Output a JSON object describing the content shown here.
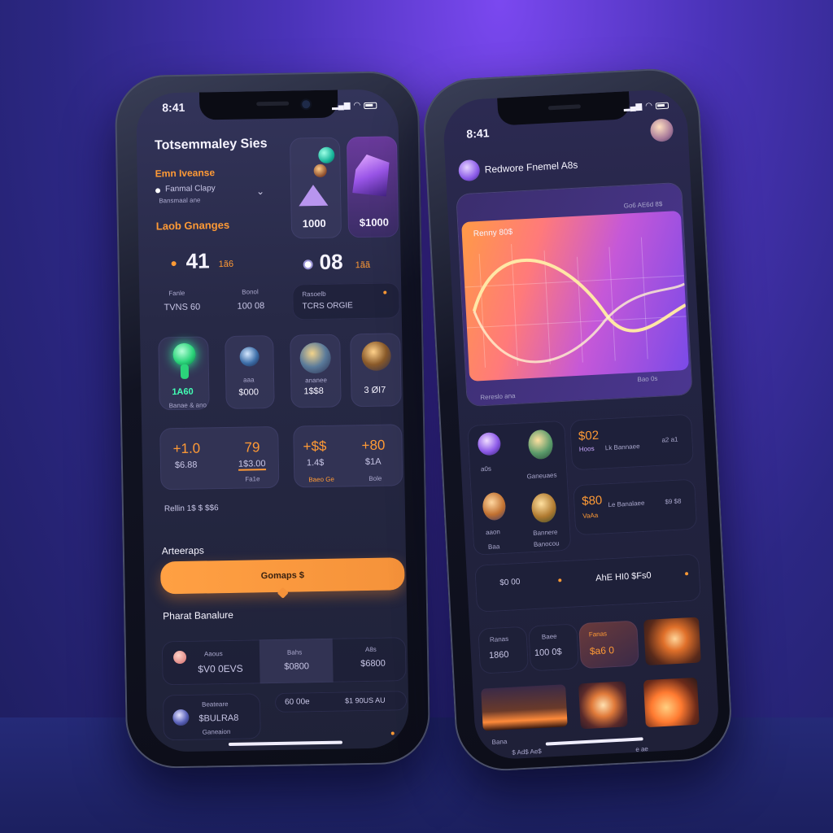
{
  "left_phone": {
    "status_time": "8:41",
    "title": "Totsemmaley Sies",
    "subtitle_orange": "Emn Iveanse",
    "option_label": "Fanmal Clapy",
    "option_sub": "Bansmaal ane",
    "section_orange": "Laob Gnanges",
    "preview_cards": [
      {
        "value": "1000"
      },
      {
        "value": "$1000"
      }
    ],
    "stat_a": {
      "value": "41",
      "unit": "1ã6"
    },
    "stat_b": {
      "value": "08",
      "unit": "1ãã"
    },
    "stat_a_col1": {
      "label": "Fanle",
      "value": "TVNS 60"
    },
    "stat_a_col2": {
      "label": "Bonol",
      "value": "100 08"
    },
    "stat_b_card": {
      "label": "Rasoelb",
      "value": "TCRS ORGIE"
    },
    "tiles": [
      {
        "value": "1A60",
        "label": "Banae & ano"
      },
      {
        "value": "$000",
        "label": "aaa"
      },
      {
        "value": "1$$8",
        "label": "ananee"
      },
      {
        "value": "3 ØI7",
        "label": ""
      }
    ],
    "pair_cards": [
      {
        "v1": "+1.0",
        "l1": "$6.88",
        "v2": "79",
        "l2": "1$3.00",
        "sub": "Fa1e"
      },
      {
        "v1": "+$$",
        "l1": "1.4$",
        "v2": "+80",
        "l2": "$1A",
        "sub1": "Baeo Ge",
        "sub2": "Bole"
      }
    ],
    "tab_row": "Rellin  1$ $  $$6",
    "section_heading": "Arteeraps",
    "button_label": "Gomaps $",
    "section_heading2": "Pharat Banalure",
    "list": [
      {
        "title": "Aaous",
        "value": "$V0 0EVS",
        "col2_title": "Bahs",
        "col2_value": "$0800",
        "col3_title": "A8s",
        "col3_value": "$6800"
      },
      {
        "title": "Beateare",
        "value": "$BULRA8",
        "sub": "Ganeaion",
        "col2_value": "60 00e",
        "col3_value": "$1 90US AU"
      }
    ]
  },
  "right_phone": {
    "status_time": "8:41",
    "header_title": "Redwore Fnemel A8s",
    "chart": {
      "title": "Renny 80$",
      "top_right": "Go6 AE6d 8$",
      "footer_left": "Rereslo ana",
      "footer_right": "Bao 0s"
    },
    "stat_rows": [
      {
        "value": "$02",
        "label": "Hoos",
        "meta": "Lk Bannaee",
        "extra": "a2 a1"
      },
      {
        "value": "$80",
        "label": "VaAa",
        "meta": "Le Banalaee",
        "extra": "$9 $8"
      }
    ],
    "orb_labels": [
      "a0s",
      "Ganeuaes",
      "aaon",
      "Bannere",
      "Baa",
      "Banocou"
    ],
    "status_row": {
      "left": "$0 00",
      "right": "AhE HI0 $Fs0"
    },
    "grid_cells": [
      {
        "title": "Ranas",
        "value": "1860"
      },
      {
        "title": "Baee",
        "value": "100 0$"
      },
      {
        "title": "Fanas",
        "value": "$a6 0"
      }
    ],
    "footer_label": "Bana",
    "footer_sub": "$ Ad$ Ae$",
    "footer_right": "e ae"
  },
  "colors": {
    "accent_orange": "#ff9a35",
    "accent_purple": "#8f5cff",
    "background": "#3a2fa8"
  }
}
